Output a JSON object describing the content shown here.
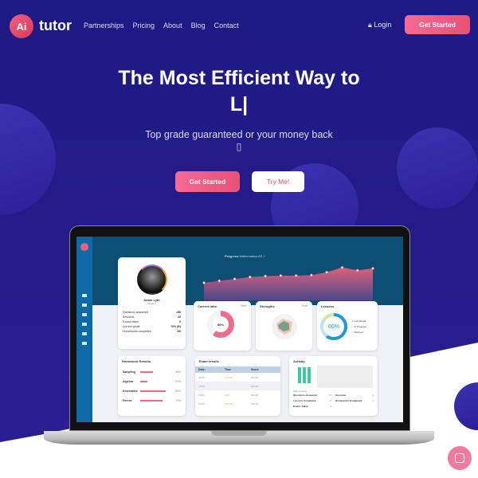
{
  "nav": {
    "logo": "Ai",
    "brand": "tutor",
    "links": [
      "Partnerships",
      "Pricing",
      "About",
      "Blog",
      "Contact"
    ],
    "login": "Login",
    "cta": "Get Started"
  },
  "hero": {
    "title_line1": "The Most Efficient Way to",
    "title_line2": "L|",
    "subtitle": "Top grade guaranteed or your money back ▯",
    "primary": "Get Started",
    "secondary": "Try Me!"
  },
  "colors": {
    "background": "#1e1a84",
    "accent": "#ef5a80",
    "dashboard_band": "#0d4f74",
    "sidebar": "#0e6aa6"
  },
  "dashboard": {
    "progress": {
      "label": "Progress",
      "subject": "Mathematics AS",
      "values": [
        30,
        34,
        38,
        42,
        44,
        45,
        45,
        46,
        52,
        62,
        56,
        60
      ]
    },
    "profile": {
      "name": "Adam Lyth",
      "role": "Student",
      "stats": [
        [
          "Questions answered",
          "156"
        ],
        [
          "Sessions",
          "20"
        ],
        [
          "Exams taken",
          "3"
        ],
        [
          "Current grade",
          "76% (B)"
        ],
        [
          "Homeworks completed",
          "4/5"
        ]
      ]
    },
    "correct_ratio": {
      "title": "Correct ratio",
      "filter": "Pure",
      "value": "60%",
      "fraction": 0.6
    },
    "strengths": {
      "title": "Strengths",
      "filter": "Pure"
    },
    "lessons": {
      "title": "Lessons",
      "value": "60%",
      "legend": [
        "Completed",
        "In Progress",
        "Planned"
      ]
    },
    "homework": {
      "title": "Homework Results",
      "items": [
        [
          "Sampling",
          "40%",
          0.4
        ],
        [
          "Algebra",
          "23%",
          0.23
        ],
        [
          "Kinematics",
          "80%",
          0.8
        ],
        [
          "Forces",
          "70%",
          0.7
        ]
      ]
    },
    "exam": {
      "title": "Exam results",
      "headers": [
        "Date",
        "Time",
        "Score"
      ],
      "rows": [
        [
          "20/05",
          "1:01:45",
          "80/100"
        ],
        [
          "18/05",
          "",
          "60/100"
        ],
        [
          "15/05",
          "4:01",
          "80/100"
        ],
        [
          "10/05",
          "0:37:55",
          "40/100"
        ]
      ]
    },
    "activity": {
      "title": "Activity",
      "note": "20th January",
      "stats": [
        [
          "Questions Answered",
          "15"
        ],
        [
          "Lessons Completed",
          "6"
        ],
        [
          "Exams Taken",
          "3"
        ],
        [
          "Sessions",
          "1"
        ],
        [
          "Homeworks Completed",
          "1"
        ]
      ]
    }
  }
}
